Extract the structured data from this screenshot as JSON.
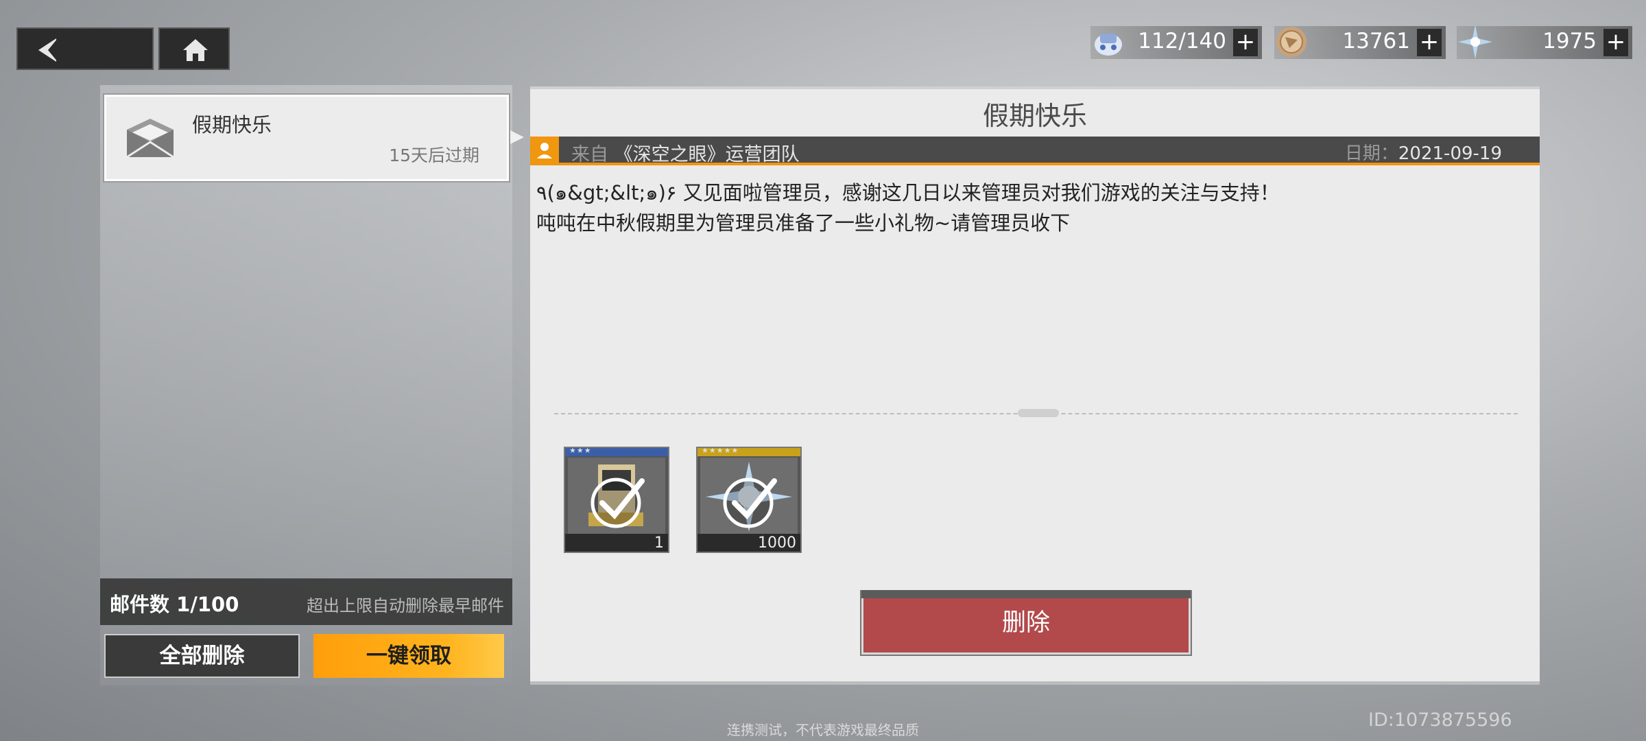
{
  "nav": {
    "back_icon": "chevron-left-icon",
    "home_icon": "home-icon"
  },
  "currencies": [
    {
      "icon": "ship-icon",
      "value": "112/140"
    },
    {
      "icon": "coin-icon",
      "value": "13761"
    },
    {
      "icon": "crystal-icon",
      "value": "1975"
    }
  ],
  "plus_label": "+",
  "mail_list": {
    "items": [
      {
        "title": "假期快乐",
        "expire": "15天后过期",
        "icon": "envelope-icon"
      }
    ],
    "count_label": "邮件数 1/100",
    "count_note": "超出上限自动删除最早邮件",
    "delete_all_label": "全部删除",
    "claim_all_label": "一键领取"
  },
  "mail": {
    "title": "假期快乐",
    "from_prefix": "来自",
    "from": "《深空之眼》运营团队",
    "date_prefix": "日期：",
    "date": "2021-09-19",
    "body_lines": [
      "٩(๑&gt;&lt;๑)۶ 又见面啦管理员，感谢这几日以来管理员对我们游戏的关注与支持！",
      "吨吨在中秋假期里为管理员准备了一些小礼物~请管理员收下"
    ],
    "attachments": [
      {
        "icon": "item-chest-icon",
        "count": "1",
        "rarity_color": "#3b5ea8",
        "stars": "★★★",
        "claimed": true
      },
      {
        "icon": "crystal-icon",
        "count": "1000",
        "rarity_color": "#c9a21a",
        "stars": "★★★★★",
        "claimed": true
      }
    ],
    "delete_label": "删除"
  },
  "footer_note": "连携测试，不代表游戏最终品质",
  "user_id": "ID:1073875596",
  "colors": {
    "accent": "#f0960f",
    "delete": "#b24a4c",
    "claim": "#ffa514"
  }
}
